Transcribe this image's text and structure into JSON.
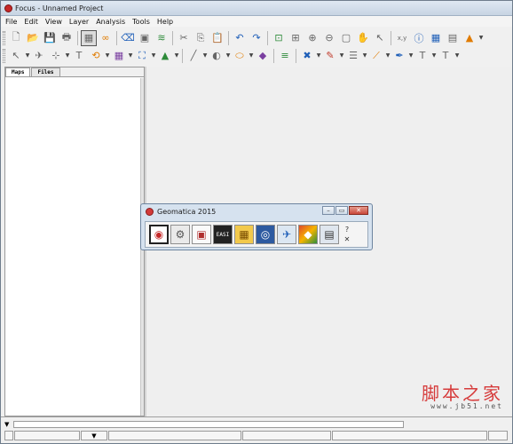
{
  "window": {
    "title": "Focus - Unnamed Project"
  },
  "menu": [
    "File",
    "Edit",
    "View",
    "Layer",
    "Analysis",
    "Tools",
    "Help"
  ],
  "toolbar1": {
    "icons": [
      "new-file-icon",
      "open-folder-icon",
      "save-icon",
      "print-icon",
      "map-view-icon",
      "link-icon",
      "eraser-icon",
      "image-icon",
      "layers-icon",
      "cut-icon",
      "copy-icon",
      "paste-icon",
      "undo-icon",
      "redo-icon",
      "zoom-extent-icon",
      "zoom-box-icon",
      "zoom-in-icon",
      "zoom-out-icon",
      "zoom-layer-icon",
      "pan-icon",
      "pointer-icon",
      "coordinate-icon",
      "info-icon",
      "table-icon",
      "edit-table-icon",
      "chart-icon"
    ],
    "glyphs": [
      "🗋",
      "📂",
      "💾",
      "🖶",
      "▦",
      "∞",
      "⌫",
      "▣",
      "≋",
      "✂",
      "⎘",
      "📋",
      "↶",
      "↷",
      "⊡",
      "⊞",
      "⊕",
      "⊖",
      "▢",
      "✋",
      "↖",
      "x,y",
      "ⓘ",
      "▦",
      "▤",
      "▲"
    ]
  },
  "toolbar2": {
    "glyphs": [
      "↖",
      "✈",
      "⊹",
      "T",
      "⟲",
      "▦",
      "⛶",
      "▲",
      "╱",
      "◐",
      "⬭",
      "◆",
      "≡",
      "✖",
      "✎",
      "☰",
      "⟋",
      "✒",
      "T",
      "T"
    ]
  },
  "left_panel": {
    "tabs": [
      "Maps",
      "Files"
    ],
    "active_tab": 0
  },
  "geomatica": {
    "title": "Geomatica 2015",
    "controls": [
      "–",
      "▭",
      "✕"
    ],
    "buttons": [
      {
        "name": "focus-eye-icon",
        "glyph": "◉"
      },
      {
        "name": "modeler-icon",
        "glyph": "⚙"
      },
      {
        "name": "easi-icon",
        "glyph": "▣"
      },
      {
        "name": "easi-console-icon",
        "glyph": "EASI"
      },
      {
        "name": "ortho-icon",
        "glyph": "▦"
      },
      {
        "name": "imageworks-icon",
        "glyph": "◎"
      },
      {
        "name": "satellite-icon",
        "glyph": "✈"
      },
      {
        "name": "dem-icon",
        "glyph": "◆"
      },
      {
        "name": "batch-icon",
        "glyph": "▤"
      }
    ],
    "side": [
      "?",
      "✕"
    ]
  },
  "statusbar": {
    "cells": [
      "",
      "",
      "▼",
      "",
      "",
      "",
      ""
    ]
  },
  "watermark": {
    "main": "脚本之家",
    "sub": "www.jb51.net"
  },
  "colors": {
    "accent": "#1f5fb8",
    "watermark": "#d63b3b",
    "close": "#c8473a"
  }
}
